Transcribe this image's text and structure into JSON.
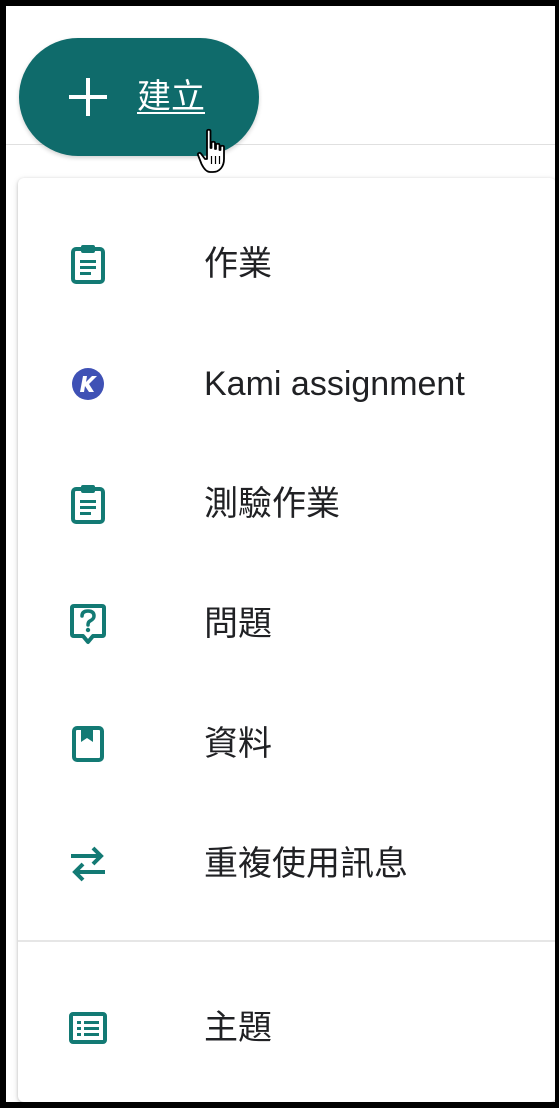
{
  "fab": {
    "label": "建立",
    "icon": "plus-icon",
    "color": "#0f6b6b"
  },
  "menu": {
    "items": [
      {
        "label": "作業",
        "icon": "assignment-clipboard-icon"
      },
      {
        "label": "Kami assignment",
        "icon": "kami-logo-icon"
      },
      {
        "label": "測驗作業",
        "icon": "quiz-clipboard-icon"
      },
      {
        "label": "問題",
        "icon": "question-icon"
      },
      {
        "label": "資料",
        "icon": "material-bookmark-icon"
      },
      {
        "label": "重複使用訊息",
        "icon": "reuse-arrows-icon"
      }
    ],
    "topic": {
      "label": "主題",
      "icon": "topic-list-icon"
    }
  },
  "colors": {
    "accent": "#0f6b6b",
    "icon": "#137a74",
    "kami": "#3f51b5",
    "text": "#202124"
  }
}
